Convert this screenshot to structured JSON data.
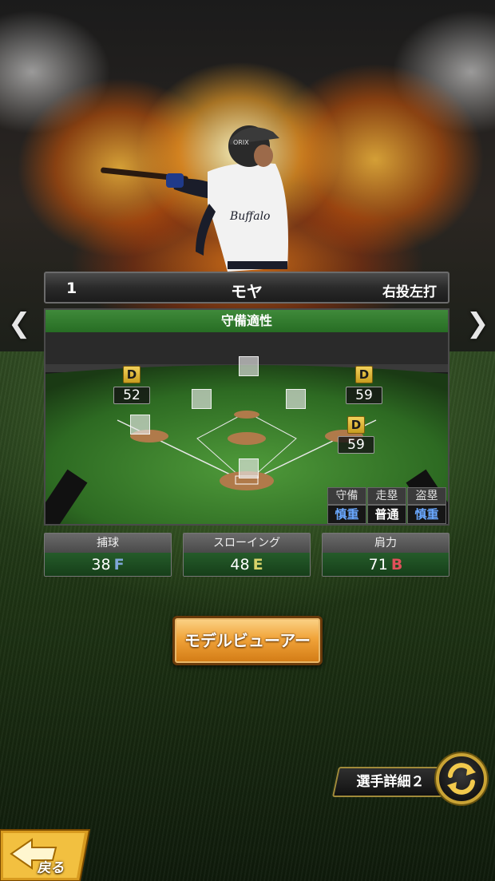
{
  "player": {
    "number": "1",
    "name": "モヤ",
    "handedness": "右投左打"
  },
  "nav": {
    "prev_arrow": "❮",
    "next_arrow": "❯"
  },
  "defense": {
    "title": "守備適性",
    "positions": [
      {
        "id": "second-base",
        "grade": "D",
        "value": "52"
      },
      {
        "id": "first-base",
        "grade": "D",
        "value": "59"
      },
      {
        "id": "left-field",
        "grade": "D",
        "value": "59"
      }
    ],
    "traits": [
      {
        "label": "守備",
        "value": "慎重",
        "color": "#6aa8ff"
      },
      {
        "label": "走塁",
        "value": "普通",
        "color": "#ffffff"
      },
      {
        "label": "盗塁",
        "value": "慎重",
        "color": "#6aa8ff"
      }
    ]
  },
  "stats": [
    {
      "label": "捕球",
      "value": "38",
      "grade": "F",
      "grade_color": "#7fa7d8"
    },
    {
      "label": "スローイング",
      "value": "48",
      "grade": "E",
      "grade_color": "#d8d36a"
    },
    {
      "label": "肩力",
      "value": "71",
      "grade": "B",
      "grade_color": "#e0505a"
    }
  ],
  "buttons": {
    "model_viewer": "モデルビューアー",
    "player_detail": "選手詳細２",
    "back": "戻る"
  },
  "icons": {
    "swap": "swap-arrows-icon",
    "back": "back-arrow-icon"
  },
  "colors": {
    "accent_gold": "#e2b23a",
    "button_orange": "#f1a43a",
    "panel_green": "#276d24"
  }
}
